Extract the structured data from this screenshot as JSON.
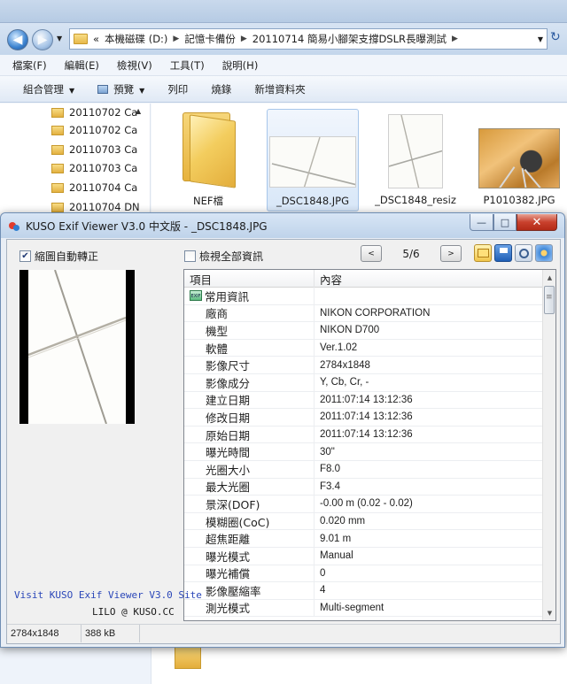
{
  "explorer": {
    "address": {
      "overflow": "«",
      "segments": [
        "本機磁碟 (D:)",
        "記憶卡備份",
        "20110714 簡易小腳架支撐DSLR長曝測試"
      ]
    },
    "menu": [
      "檔案(F)",
      "編輯(E)",
      "檢視(V)",
      "工具(T)",
      "說明(H)"
    ],
    "toolbar": [
      "組合管理",
      "預覽",
      "列印",
      "燒錄",
      "新增資料夾"
    ],
    "tree": [
      "20110702 Ca",
      "20110702 Ca",
      "20110703 Ca",
      "20110703 Ca",
      "20110704 Ca",
      "20110704 DN"
    ],
    "files": [
      {
        "name": "NEF檔",
        "icon": "folder-icon"
      },
      {
        "name": "_DSC1848.JPG",
        "icon": "photo-thumbnail"
      },
      {
        "name": "_DSC1848_resiz",
        "icon": "photo-thumbnail"
      },
      {
        "name": "P1010382.JPG",
        "icon": "photo-thumbnail"
      }
    ]
  },
  "kuso": {
    "title": "KUSO Exif Viewer V3.0 中文版 - _DSC1848.JPG",
    "autorotate_label": "縮圖自動轉正",
    "viewall_label": "檢視全部資訊",
    "autorotate_checked": true,
    "viewall_checked": false,
    "page": "5/6",
    "prev_label": "<",
    "next_label": ">",
    "columns": {
      "item": "項目",
      "value": "內容"
    },
    "group": "常用資訊",
    "group_icon_text": "EXIF",
    "rows": [
      {
        "k": "廠商",
        "v": "NIKON CORPORATION"
      },
      {
        "k": "機型",
        "v": "NIKON D700"
      },
      {
        "k": "軟體",
        "v": "Ver.1.02"
      },
      {
        "k": "影像尺寸",
        "v": "2784x1848"
      },
      {
        "k": "影像成分",
        "v": "Y, Cb, Cr, -"
      },
      {
        "k": "建立日期",
        "v": "2011:07:14 13:12:36"
      },
      {
        "k": "修改日期",
        "v": "2011:07:14 13:12:36"
      },
      {
        "k": "原始日期",
        "v": "2011:07:14 13:12:36"
      },
      {
        "k": "曝光時間",
        "v": "30\""
      },
      {
        "k": "光圈大小",
        "v": "F8.0"
      },
      {
        "k": "最大光圈",
        "v": "F3.4"
      },
      {
        "k": "景深(DOF)",
        "v": "-0.00 m (0.02 - 0.02)"
      },
      {
        "k": "模糊圈(CoC)",
        "v": "0.020 mm"
      },
      {
        "k": "超焦距離",
        "v": "9.01 m"
      },
      {
        "k": "曝光模式",
        "v": "Manual"
      },
      {
        "k": "曝光補償",
        "v": "0"
      },
      {
        "k": "影像壓縮率",
        "v": "4"
      },
      {
        "k": "測光模式",
        "v": "Multi-segment"
      }
    ],
    "promo_link": "Visit KUSO Exif Viewer V3.0 Site",
    "promo_author": "LILO @ KUSO.CC",
    "status": {
      "dimensions": "2784x1848",
      "size": "388 kB"
    }
  }
}
